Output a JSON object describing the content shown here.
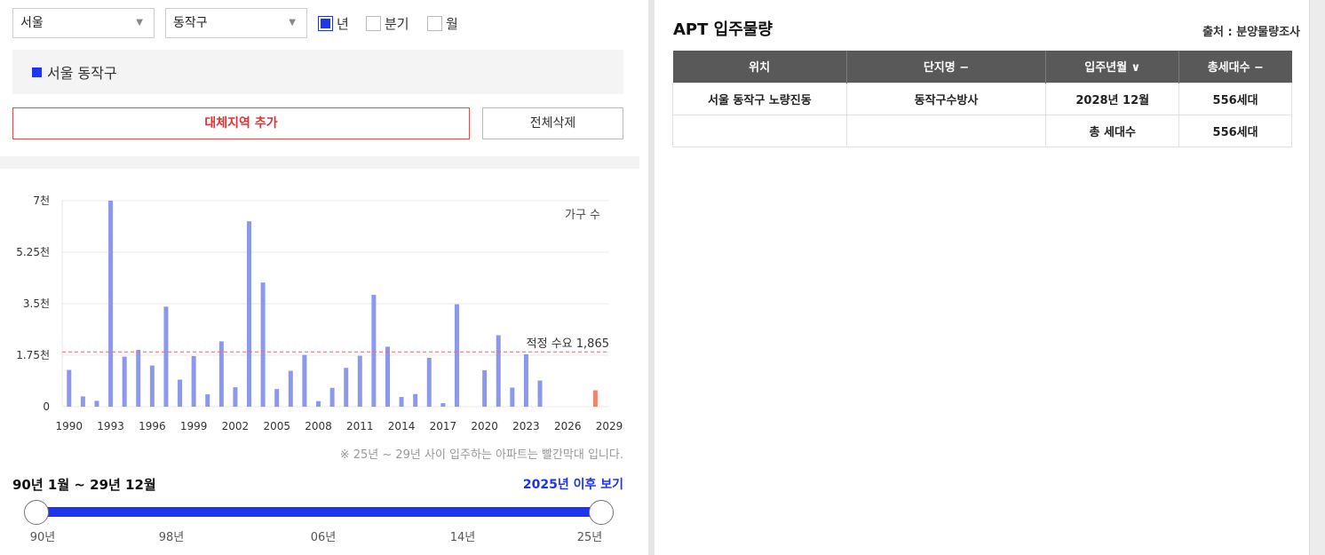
{
  "filters": {
    "city": "서울",
    "district": "동작구",
    "periods": [
      {
        "label": "년",
        "checked": true
      },
      {
        "label": "분기",
        "checked": false
      },
      {
        "label": "월",
        "checked": false
      }
    ]
  },
  "region_tag": "서울 동작구",
  "buttons": {
    "add_region": "대체지역 추가",
    "delete_all": "전체삭제"
  },
  "chart_data": {
    "type": "bar",
    "series_label": "가구 수",
    "y_ticks": [
      "7천",
      "5.25천",
      "3.5천",
      "1.75천",
      "0"
    ],
    "ylim": [
      0,
      7000
    ],
    "x_ticks": [
      "1990",
      "1993",
      "1996",
      "1999",
      "2002",
      "2005",
      "2008",
      "2011",
      "2014",
      "2017",
      "2020",
      "2023",
      "2026",
      "2029"
    ],
    "years": [
      1990,
      1991,
      1992,
      1993,
      1994,
      1995,
      1996,
      1997,
      1998,
      1999,
      2000,
      2001,
      2002,
      2003,
      2004,
      2005,
      2006,
      2007,
      2008,
      2009,
      2010,
      2011,
      2012,
      2013,
      2014,
      2015,
      2016,
      2017,
      2018,
      2019,
      2020,
      2021,
      2022,
      2023,
      2024,
      2025,
      2026,
      2027,
      2028
    ],
    "values": [
      1250,
      350,
      200,
      7000,
      1700,
      1930,
      1400,
      3400,
      920,
      1720,
      420,
      2220,
      660,
      6300,
      4220,
      600,
      1220,
      1760,
      190,
      640,
      1320,
      1730,
      3800,
      2040,
      330,
      430,
      1660,
      120,
      3480,
      0,
      1240,
      2430,
      650,
      1780,
      890,
      0,
      0,
      0,
      556
    ],
    "highlight_from_year": 2025,
    "bar_color": "#8c98ec",
    "highlight_color": "#f2836b",
    "reference_line": {
      "value": 1865,
      "label": "적정 수요 1,865",
      "color": "#e96a6a"
    }
  },
  "note": "※ 25년 ~ 29년 사이 입주하는 아파트는 빨간막대 입니다.",
  "range": {
    "label": "90년 1월 ~ 29년 12월",
    "after_link": "2025년 이후 보기",
    "ticks": [
      "90년",
      "98년",
      "06년",
      "14년",
      "25년"
    ]
  },
  "apt": {
    "title": "APT 입주물량",
    "source": "출처 : 분양물량조사",
    "columns": [
      "위치",
      "단지명 −",
      "입주년월 ∨",
      "총세대수 −"
    ],
    "rows": [
      [
        "서울 동작구 노량진동",
        "동작구수방사",
        "2028년 12월",
        "556세대"
      ],
      [
        "",
        "",
        "총 세대수",
        "556세대"
      ]
    ]
  }
}
